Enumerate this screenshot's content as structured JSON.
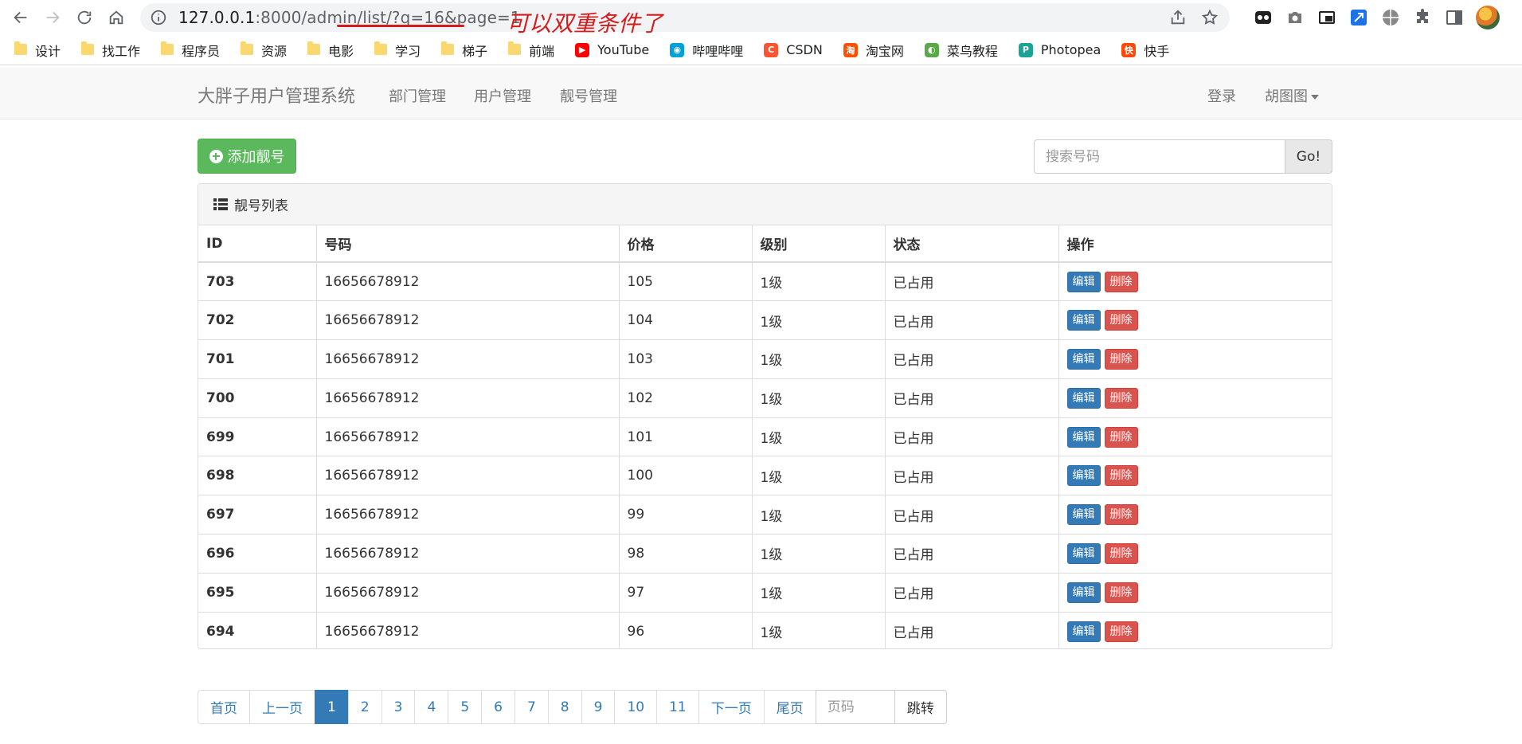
{
  "browser": {
    "url_main": "127.0.0.1",
    "url_dim": ":8000/admin/list/?q=16&page=1",
    "annotation": "可以双重条件了"
  },
  "bookmarks": [
    {
      "label": "设计",
      "icon": "folder-icon"
    },
    {
      "label": "找工作",
      "icon": "folder-icon"
    },
    {
      "label": "程序员",
      "icon": "folder-icon"
    },
    {
      "label": "资源",
      "icon": "folder-icon"
    },
    {
      "label": "电影",
      "icon": "folder-icon"
    },
    {
      "label": "学习",
      "icon": "folder-icon"
    },
    {
      "label": "梯子",
      "icon": "folder-icon"
    },
    {
      "label": "前端",
      "icon": "folder-icon"
    },
    {
      "label": "YouTube",
      "icon": "youtube-icon",
      "color": "#ff0000"
    },
    {
      "label": "哔哩哔哩",
      "icon": "bilibili-icon",
      "color": "#00a1d6"
    },
    {
      "label": "CSDN",
      "icon": "csdn-icon",
      "color": "#fc5531"
    },
    {
      "label": "淘宝网",
      "icon": "taobao-icon",
      "color": "#ff5000"
    },
    {
      "label": "菜鸟教程",
      "icon": "runoob-icon",
      "color": "#5aa949"
    },
    {
      "label": "Photopea",
      "icon": "photopea-icon",
      "color": "#18a497"
    },
    {
      "label": "快手",
      "icon": "kuaishou-icon",
      "color": "#ff4906"
    }
  ],
  "navbar": {
    "brand": "大胖子用户管理系统",
    "links": [
      "部门管理",
      "用户管理",
      "靓号管理"
    ],
    "login": "登录",
    "user": "胡图图"
  },
  "toolbar": {
    "add_label": "添加靓号",
    "search_placeholder": "搜索号码",
    "go_label": "Go!"
  },
  "panel": {
    "title": "靓号列表",
    "columns": [
      "ID",
      "号码",
      "价格",
      "级别",
      "状态",
      "操作"
    ],
    "edit_label": "编辑",
    "delete_label": "删除",
    "rows": [
      {
        "id": "703",
        "mobile": "16656678912",
        "price": "105",
        "level": "1级",
        "status": "已占用"
      },
      {
        "id": "702",
        "mobile": "16656678912",
        "price": "104",
        "level": "1级",
        "status": "已占用"
      },
      {
        "id": "701",
        "mobile": "16656678912",
        "price": "103",
        "level": "1级",
        "status": "已占用"
      },
      {
        "id": "700",
        "mobile": "16656678912",
        "price": "102",
        "level": "1级",
        "status": "已占用"
      },
      {
        "id": "699",
        "mobile": "16656678912",
        "price": "101",
        "level": "1级",
        "status": "已占用"
      },
      {
        "id": "698",
        "mobile": "16656678912",
        "price": "100",
        "level": "1级",
        "status": "已占用"
      },
      {
        "id": "697",
        "mobile": "16656678912",
        "price": "99",
        "level": "1级",
        "status": "已占用"
      },
      {
        "id": "696",
        "mobile": "16656678912",
        "price": "98",
        "level": "1级",
        "status": "已占用"
      },
      {
        "id": "695",
        "mobile": "16656678912",
        "price": "97",
        "level": "1级",
        "status": "已占用"
      },
      {
        "id": "694",
        "mobile": "16656678912",
        "price": "96",
        "level": "1级",
        "status": "已占用"
      }
    ]
  },
  "pagination": {
    "first": "首页",
    "prev": "上一页",
    "pages": [
      "1",
      "2",
      "3",
      "4",
      "5",
      "6",
      "7",
      "8",
      "9",
      "10",
      "11"
    ],
    "active": "1",
    "next": "下一页",
    "last": "尾页",
    "input_placeholder": "页码",
    "jump": "跳转"
  }
}
